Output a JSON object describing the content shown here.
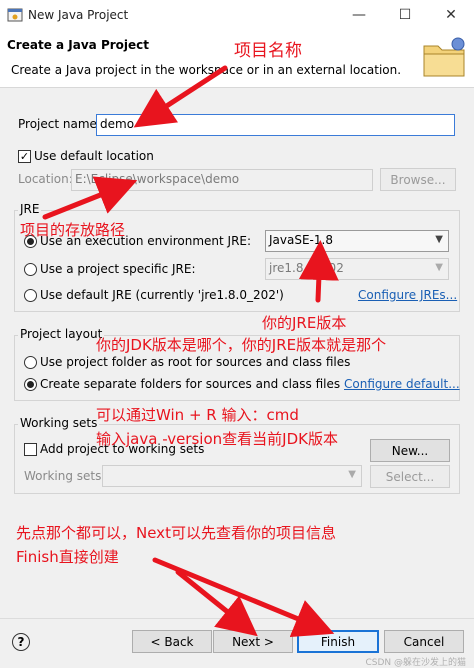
{
  "window": {
    "title": "New Java Project",
    "minimize": "—",
    "maximize": "☐",
    "close": "✕"
  },
  "header": {
    "title": "Create a Java Project",
    "description": "Create a Java project in the workspace or in an external location."
  },
  "project_name": {
    "label": "Project name:",
    "value": "demo"
  },
  "use_default_location": {
    "label": "Use default location",
    "checked": true
  },
  "location": {
    "label": "Location:",
    "value": "E:\\Eclipse\\workspace\\demo",
    "browse": "Browse..."
  },
  "jre": {
    "group_label": "JRE",
    "option_env": "Use an execution environment JRE:",
    "env_value": "JavaSE-1.8",
    "option_specific": "Use a project specific JRE:",
    "specific_value": "jre1.8.0_202",
    "option_default": "Use default JRE (currently 'jre1.8.0_202')",
    "configure_link": "Configure JREs..."
  },
  "project_layout": {
    "group_label": "Project layout",
    "option_root": "Use project folder as root for sources and class files",
    "option_separate": "Create separate folders for sources and class files",
    "configure_link": "Configure default..."
  },
  "working_sets": {
    "group_label": "Working sets",
    "add_label": "Add project to working sets",
    "new_button": "New...",
    "sets_label": "Working sets:",
    "select_button": "Select..."
  },
  "buttons": {
    "back": "< Back",
    "next": "Next >",
    "finish": "Finish",
    "cancel": "Cancel",
    "help": "?"
  },
  "annotations": {
    "project_name": "项目名称",
    "location": "项目的存放路径",
    "jre_version": "你的JRE版本",
    "jdk_note": "你的JDK版本是哪个，你的JRE版本就是那个",
    "cmd_line1": "可以通过Win + R 输入：cmd",
    "cmd_line2": "输入java -version查看当前JDK版本",
    "finish_line1": "先点那个都可以，Next可以先查看你的项目信息",
    "finish_line2": "Finish直接创建"
  },
  "watermark": "CSDN @躲在沙发上的猫",
  "colors": {
    "annotation": "#e8141e",
    "link": "#1a5fb4",
    "primary_border": "#1a73d6"
  }
}
